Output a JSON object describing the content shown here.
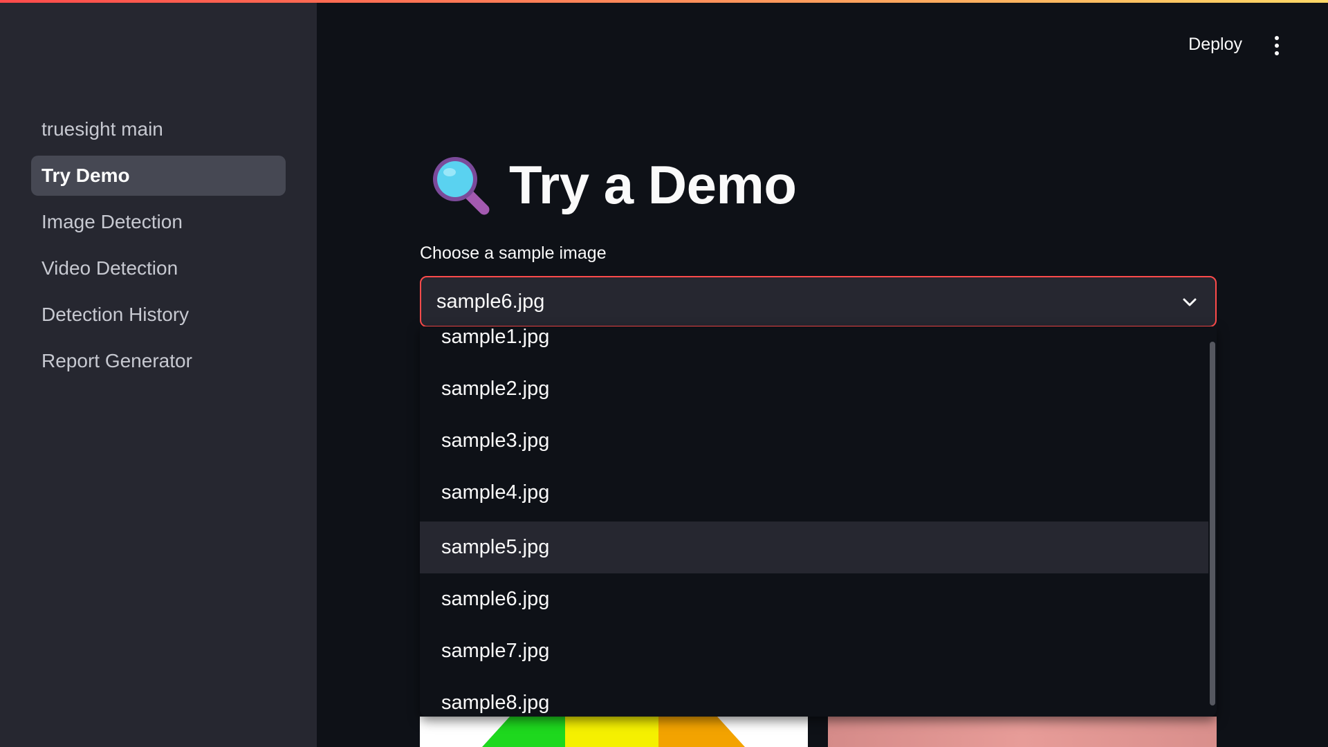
{
  "app": {
    "accent_color": "#ff4b4b",
    "background": "#0e1117",
    "sidebar_background": "#262730"
  },
  "sidebar": {
    "items": [
      {
        "label": "truesight main",
        "active": false
      },
      {
        "label": "Try Demo",
        "active": true
      },
      {
        "label": "Image Detection",
        "active": false
      },
      {
        "label": "Video Detection",
        "active": false
      },
      {
        "label": "Detection History",
        "active": false
      },
      {
        "label": "Report Generator",
        "active": false
      }
    ]
  },
  "header": {
    "deploy_label": "Deploy",
    "menu_icon": "vertical-dots-icon"
  },
  "main": {
    "title_icon": "magnifying-glass-icon",
    "title": "Try a Demo",
    "select": {
      "label": "Choose a sample image",
      "value": "sample6.jpg",
      "open": true,
      "highlighted_option": "sample5.jpg",
      "options": [
        "sample1.jpg",
        "sample2.jpg",
        "sample3.jpg",
        "sample4.jpg",
        "sample5.jpg",
        "sample6.jpg",
        "sample7.jpg",
        "sample8.jpg"
      ]
    }
  }
}
